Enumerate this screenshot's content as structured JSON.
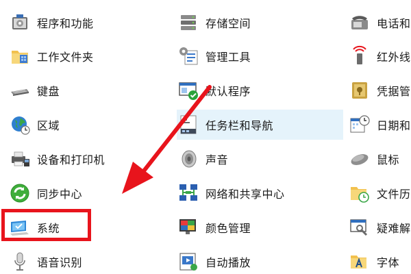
{
  "control_panel": {
    "columns": [
      {
        "items": [
          {
            "label": "程序和功能",
            "icon": "programs-features-icon"
          },
          {
            "label": "工作文件夹",
            "icon": "work-folders-icon"
          },
          {
            "label": "键盘",
            "icon": "keyboard-icon"
          },
          {
            "label": "区域",
            "icon": "region-globe-icon"
          },
          {
            "label": "设备和打印机",
            "icon": "devices-printers-icon"
          },
          {
            "label": "同步中心",
            "icon": "sync-center-icon"
          },
          {
            "label": "系统",
            "icon": "system-monitor-icon"
          },
          {
            "label": "语音识别",
            "icon": "microphone-icon"
          }
        ]
      },
      {
        "items": [
          {
            "label": "存储空间",
            "icon": "storage-spaces-icon"
          },
          {
            "label": "管理工具",
            "icon": "admin-tools-icon"
          },
          {
            "label": "默认程序",
            "icon": "default-programs-icon"
          },
          {
            "label": "任务栏和导航",
            "icon": "taskbar-navigation-icon"
          },
          {
            "label": "声音",
            "icon": "speaker-icon"
          },
          {
            "label": "网络和共享中心",
            "icon": "network-sharing-icon"
          },
          {
            "label": "颜色管理",
            "icon": "color-management-icon"
          },
          {
            "label": "自动播放",
            "icon": "autoplay-icon"
          }
        ]
      },
      {
        "items": [
          {
            "label": "电话和",
            "icon": "phone-modem-icon"
          },
          {
            "label": "红外线",
            "icon": "infrared-icon"
          },
          {
            "label": "凭据管",
            "icon": "credential-manager-icon"
          },
          {
            "label": "日期和",
            "icon": "date-time-icon"
          },
          {
            "label": "鼠标",
            "icon": "mouse-icon"
          },
          {
            "label": "文件历",
            "icon": "file-history-icon"
          },
          {
            "label": "疑难解",
            "icon": "troubleshooting-icon"
          },
          {
            "label": "字体",
            "icon": "fonts-icon"
          }
        ]
      }
    ],
    "hovered_item": "任务栏和导航",
    "highlighted_item": "系统",
    "colors": {
      "hover_background": "#e5f3fb",
      "annotation_red": "#e8141c",
      "text": "#1a1a1a"
    }
  }
}
